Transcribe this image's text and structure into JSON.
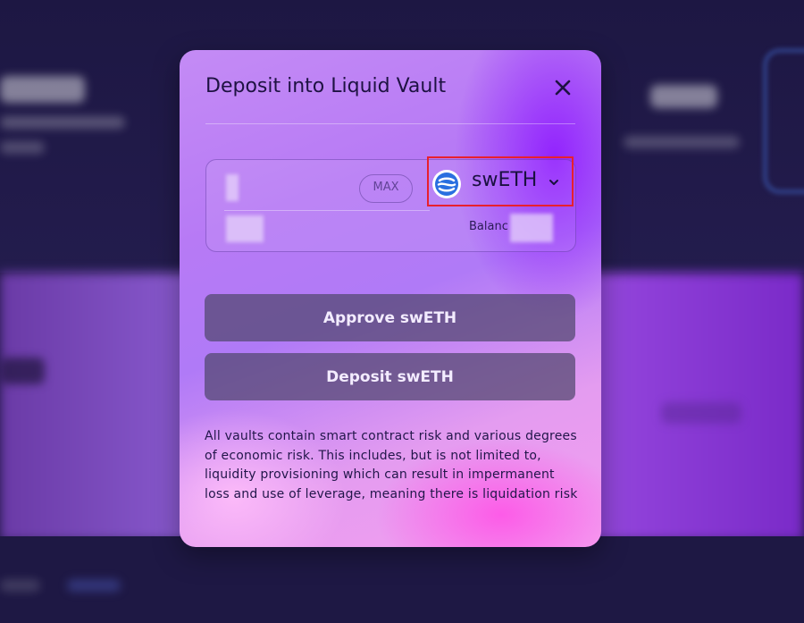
{
  "modal": {
    "title": "Deposit into Liquid Vault",
    "close_icon": "close-icon"
  },
  "deposit_form": {
    "amount_value": "",
    "max_label": "MAX",
    "token": {
      "symbol": "swETH",
      "logo_icon": "sweth-logo-icon",
      "dropdown_icon": "chevron-down-icon"
    },
    "balance_label": "Balanc"
  },
  "actions": {
    "approve_label": "Approve swETH",
    "deposit_label": "Deposit swETH"
  },
  "disclaimer": "All vaults contain smart contract risk and various degrees of economic risk. This includes, but is not limited to, liquidity provisioning which can result in impermanent loss and use of leverage, meaning there is liquidation risk",
  "colors": {
    "highlight_border": "#e8202e",
    "button_bg": "#504670",
    "title_text": "#1e1242"
  }
}
